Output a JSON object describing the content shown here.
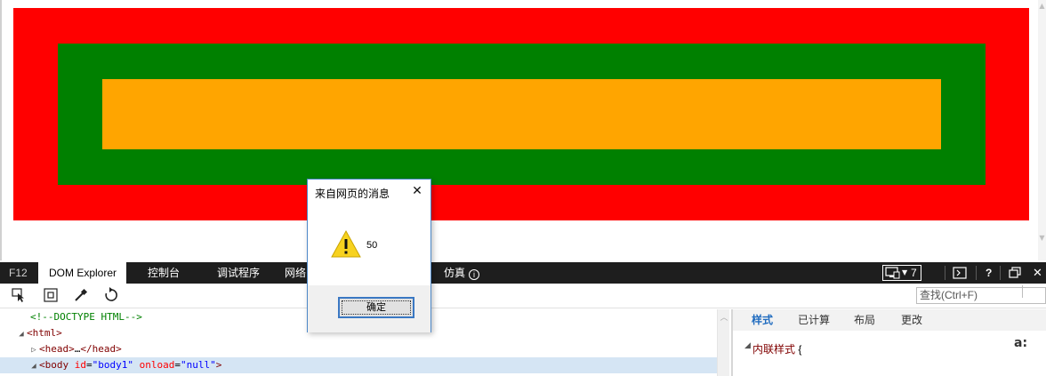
{
  "devtools": {
    "tabs": [
      {
        "label": "F12"
      },
      {
        "label": "DOM Explorer"
      },
      {
        "label": "控制台"
      },
      {
        "label": "调试程序"
      },
      {
        "label": "网络"
      },
      {
        "label": "仿真"
      }
    ],
    "document_mode": "7",
    "search_placeholder": "查找(Ctrl+F)",
    "dom_tree": {
      "doctype": "<!--DOCTYPE HTML-->",
      "html_open": "<html>",
      "head_open": "<head>",
      "head_ellipsis": "…",
      "head_close": "</head>",
      "body_tag_open": "<body",
      "body_attr_id": "id",
      "body_attr_id_value": "\"body1\"",
      "body_attr_onload": "onload",
      "body_attr_onload_value": "\"null\"",
      "body_tag_close": ">"
    },
    "styles_tabs": [
      "样式",
      "已计算",
      "布局",
      "更改"
    ],
    "inline_style_label": "内联样式",
    "inline_style_brace": "{"
  },
  "page": {
    "colors": {
      "outer": "#ff0000",
      "middle": "#008000",
      "inner": "#ffa500"
    }
  },
  "dialog": {
    "title": "来自网页的消息",
    "message": "50",
    "ok_label": "确定",
    "icon": "warning-icon"
  }
}
